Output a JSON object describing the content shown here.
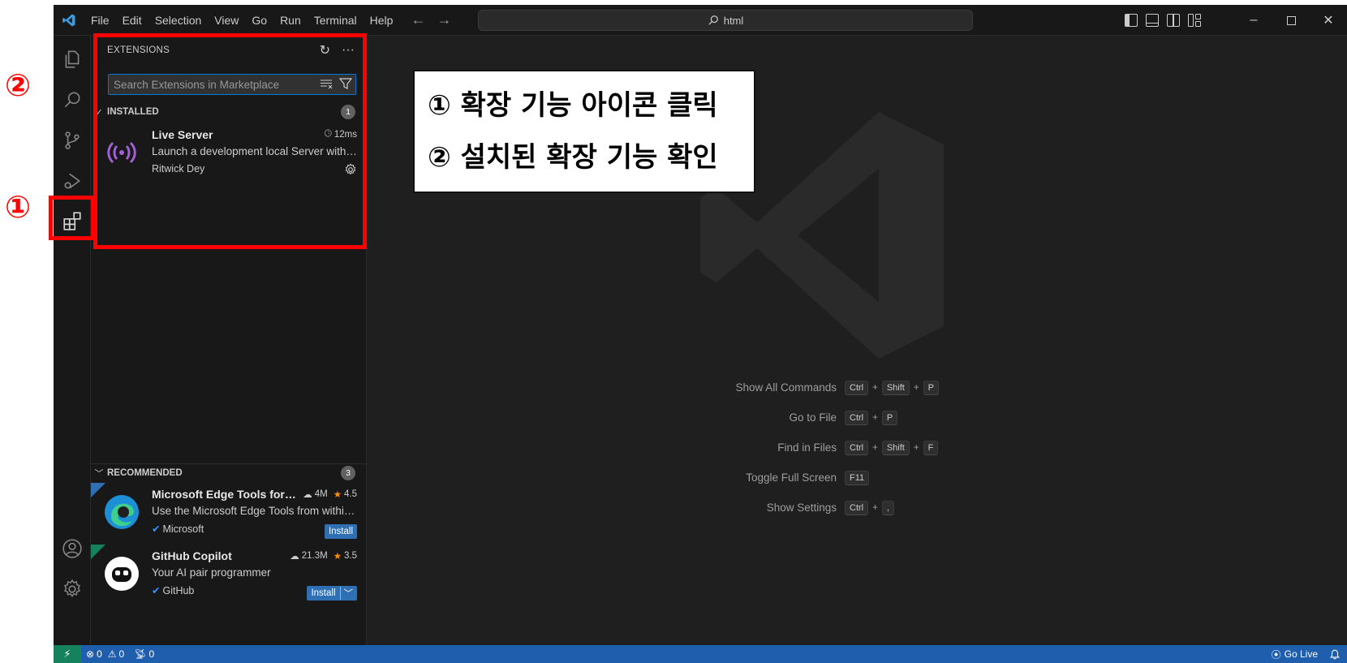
{
  "menu": [
    "File",
    "Edit",
    "Selection",
    "View",
    "Go",
    "Run",
    "Terminal",
    "Help"
  ],
  "command_center": {
    "text": "html"
  },
  "sidebar": {
    "title": "EXTENSIONS",
    "search_placeholder": "Search Extensions in Marketplace",
    "installed": {
      "label": "INSTALLED",
      "count": "1",
      "items": [
        {
          "name": "Live Server",
          "meta": "12ms",
          "description": "Launch a development local Server with live reload feature for static & dynamic pages",
          "publisher": "Ritwick Dey"
        }
      ]
    },
    "recommended": {
      "label": "RECOMMENDED",
      "count": "3",
      "items": [
        {
          "name": "Microsoft Edge Tools for VS Code",
          "downloads": "4M",
          "rating": "4.5",
          "description": "Use the Microsoft Edge Tools from within VS Code",
          "publisher": "Microsoft",
          "install_label": "Install"
        },
        {
          "name": "GitHub Copilot",
          "downloads": "21.3M",
          "rating": "3.5",
          "description": "Your AI pair programmer",
          "publisher": "GitHub",
          "install_label": "Install"
        }
      ]
    }
  },
  "shortcuts": [
    {
      "label": "Show All Commands",
      "keys": [
        "Ctrl",
        "Shift",
        "P"
      ]
    },
    {
      "label": "Go to File",
      "keys": [
        "Ctrl",
        "P"
      ]
    },
    {
      "label": "Find in Files",
      "keys": [
        "Ctrl",
        "Shift",
        "F"
      ]
    },
    {
      "label": "Toggle Full Screen",
      "keys": [
        "F11"
      ]
    },
    {
      "label": "Show Settings",
      "keys": [
        "Ctrl",
        ","
      ]
    }
  ],
  "statusbar": {
    "errors": "0",
    "warnings": "0",
    "ports": "0",
    "go_live": "Go Live"
  },
  "annotations": {
    "marker_1": "①",
    "marker_2": "②",
    "callout_line_1": "① 확장 기능 아이콘 클릭",
    "callout_line_2": "② 설치된 확장 기능 확인"
  },
  "colors": {
    "accent": "#0078d4",
    "statusbar": "#1f5dad",
    "annotation": "#ff0000",
    "live_server": "#a05fd4"
  }
}
